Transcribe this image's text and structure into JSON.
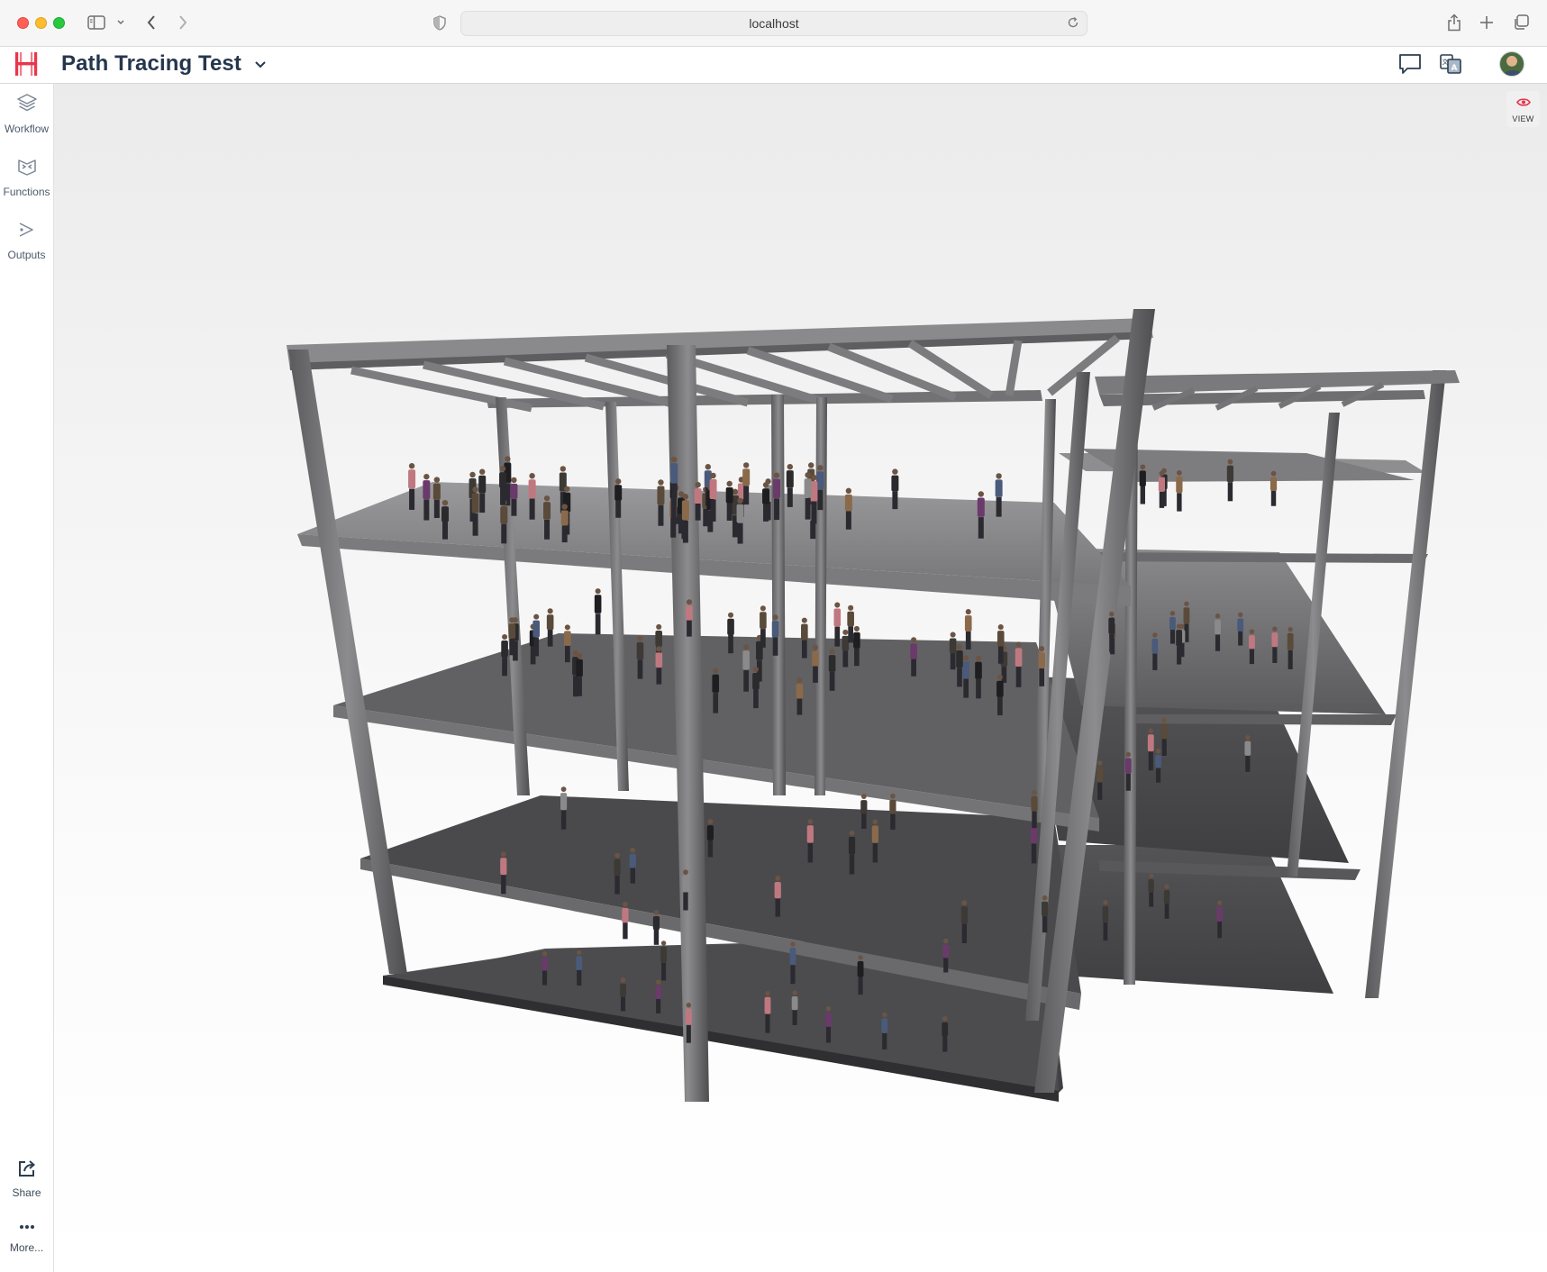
{
  "browser": {
    "url": "localhost"
  },
  "app": {
    "title": "Path Tracing Test"
  },
  "sidebar": {
    "items": [
      {
        "label": "Workflow",
        "icon": "layers-icon"
      },
      {
        "label": "Functions",
        "icon": "function-block-icon"
      },
      {
        "label": "Outputs",
        "icon": "output-arrow-icon"
      }
    ],
    "bottom": [
      {
        "label": "Share",
        "icon": "share-icon"
      },
      {
        "label": "More...",
        "icon": "ellipsis-icon"
      }
    ]
  },
  "viewport": {
    "view_label": "VIEW",
    "view_icon": "eye-icon",
    "accent_color": "#e8364a",
    "scene": "path-traced render of a multi-storey concrete frame building with people on each floor"
  },
  "colors": {
    "brand": "#e8364a",
    "title": "#25374d"
  }
}
